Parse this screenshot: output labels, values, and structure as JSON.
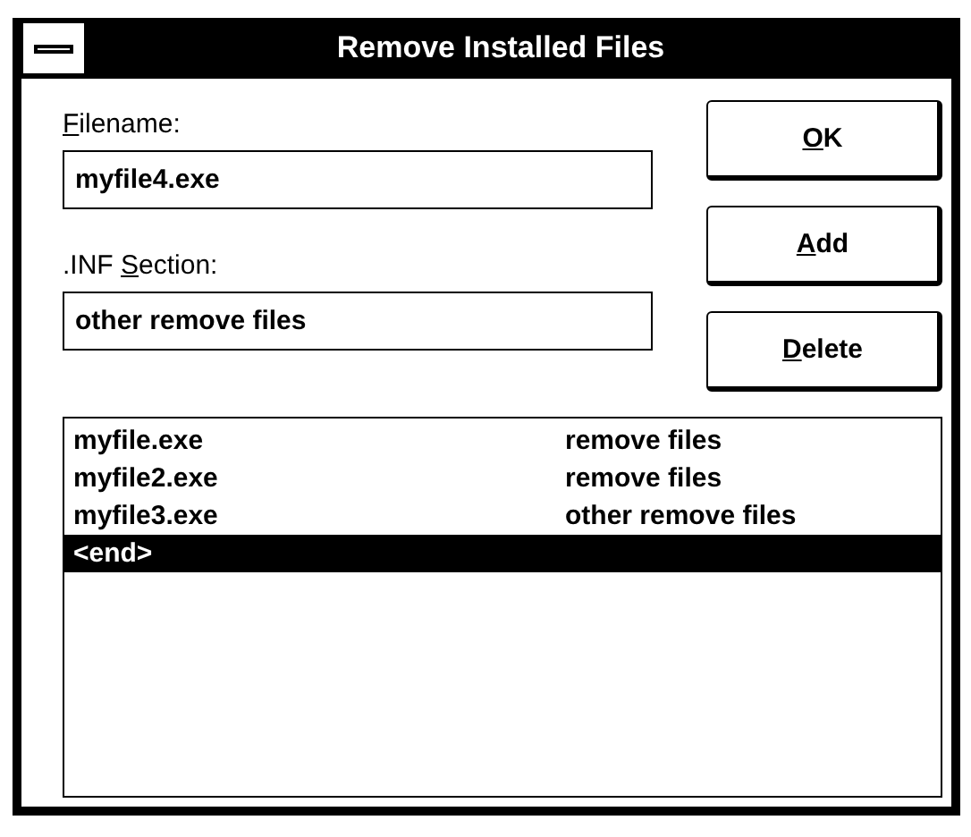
{
  "window": {
    "title": "Remove Installed Files"
  },
  "fields": [
    {
      "label": {
        "key": "F",
        "after": "ilename:"
      },
      "value": "myfile4.exe"
    },
    {
      "label": {
        "before": ".INF ",
        "key": "S",
        "after": "ection:"
      },
      "value": "other remove files"
    }
  ],
  "buttons": [
    {
      "key": "O",
      "after": "K"
    },
    {
      "key": "A",
      "after": "dd"
    },
    {
      "key": "D",
      "after": "elete"
    }
  ],
  "list": [
    {
      "file": "myfile.exe",
      "section": "remove files",
      "selected": false
    },
    {
      "file": "myfile2.exe",
      "section": "remove files",
      "selected": false
    },
    {
      "file": "myfile3.exe",
      "section": "other remove files",
      "selected": false
    },
    {
      "file": "<end>",
      "selected": true
    }
  ]
}
